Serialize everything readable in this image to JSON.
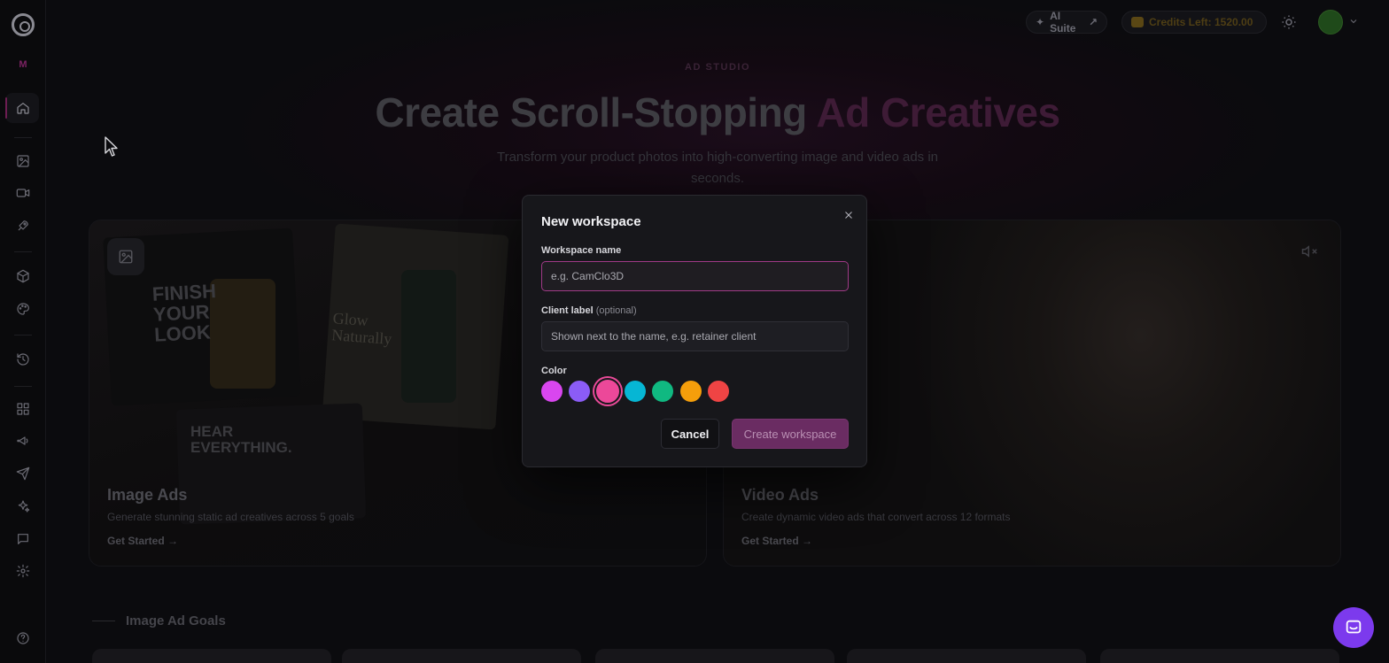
{
  "sidebar": {
    "workspace_initial": "M",
    "icons": [
      "home-icon",
      "image-icon",
      "video-icon",
      "rocket-icon",
      "box-icon",
      "palette-icon",
      "history-icon",
      "grid-icon",
      "megaphone-icon",
      "send-icon",
      "sparkle-icon",
      "message-icon",
      "settings-icon",
      "help-icon"
    ]
  },
  "topbar": {
    "ai_suite_label": "AI Suite",
    "credits_label": "Credits Left: 1520.00"
  },
  "hero": {
    "tag": "AD STUDIO",
    "title_main": "Create Scroll-Stopping",
    "title_accent": "Ad Creatives",
    "subtitle": "Transform your product photos into high-converting image and video ads in seconds."
  },
  "cards": {
    "image": {
      "title": "Image Ads",
      "description": "Generate stunning static ad creatives across 5 goals",
      "cta": "Get Started",
      "photo_text_1": "FINISH YOUR LOOK",
      "photo_text_2": "Glow Naturally",
      "photo_text_3": "HEAR EVERYTHING."
    },
    "video": {
      "title": "Video Ads",
      "description": "Create dynamic video ads that convert across 12 formats",
      "cta": "Get Started"
    }
  },
  "goals": {
    "title": "Image Ad Goals"
  },
  "modal": {
    "title": "New workspace",
    "name_label": "Workspace name",
    "name_placeholder": "e.g. CamClo3D",
    "name_value": "",
    "client_label": "Client label",
    "client_optional": "(optional)",
    "client_placeholder": "Shown next to the name, e.g. retainer client",
    "client_value": "",
    "color_label": "Color",
    "colors": [
      "#d946ef",
      "#8b5cf6",
      "#ec4899",
      "#06b6d4",
      "#10b981",
      "#f59e0b",
      "#ef4444"
    ],
    "selected_color_index": 2,
    "cancel_label": "Cancel",
    "create_label": "Create workspace"
  }
}
